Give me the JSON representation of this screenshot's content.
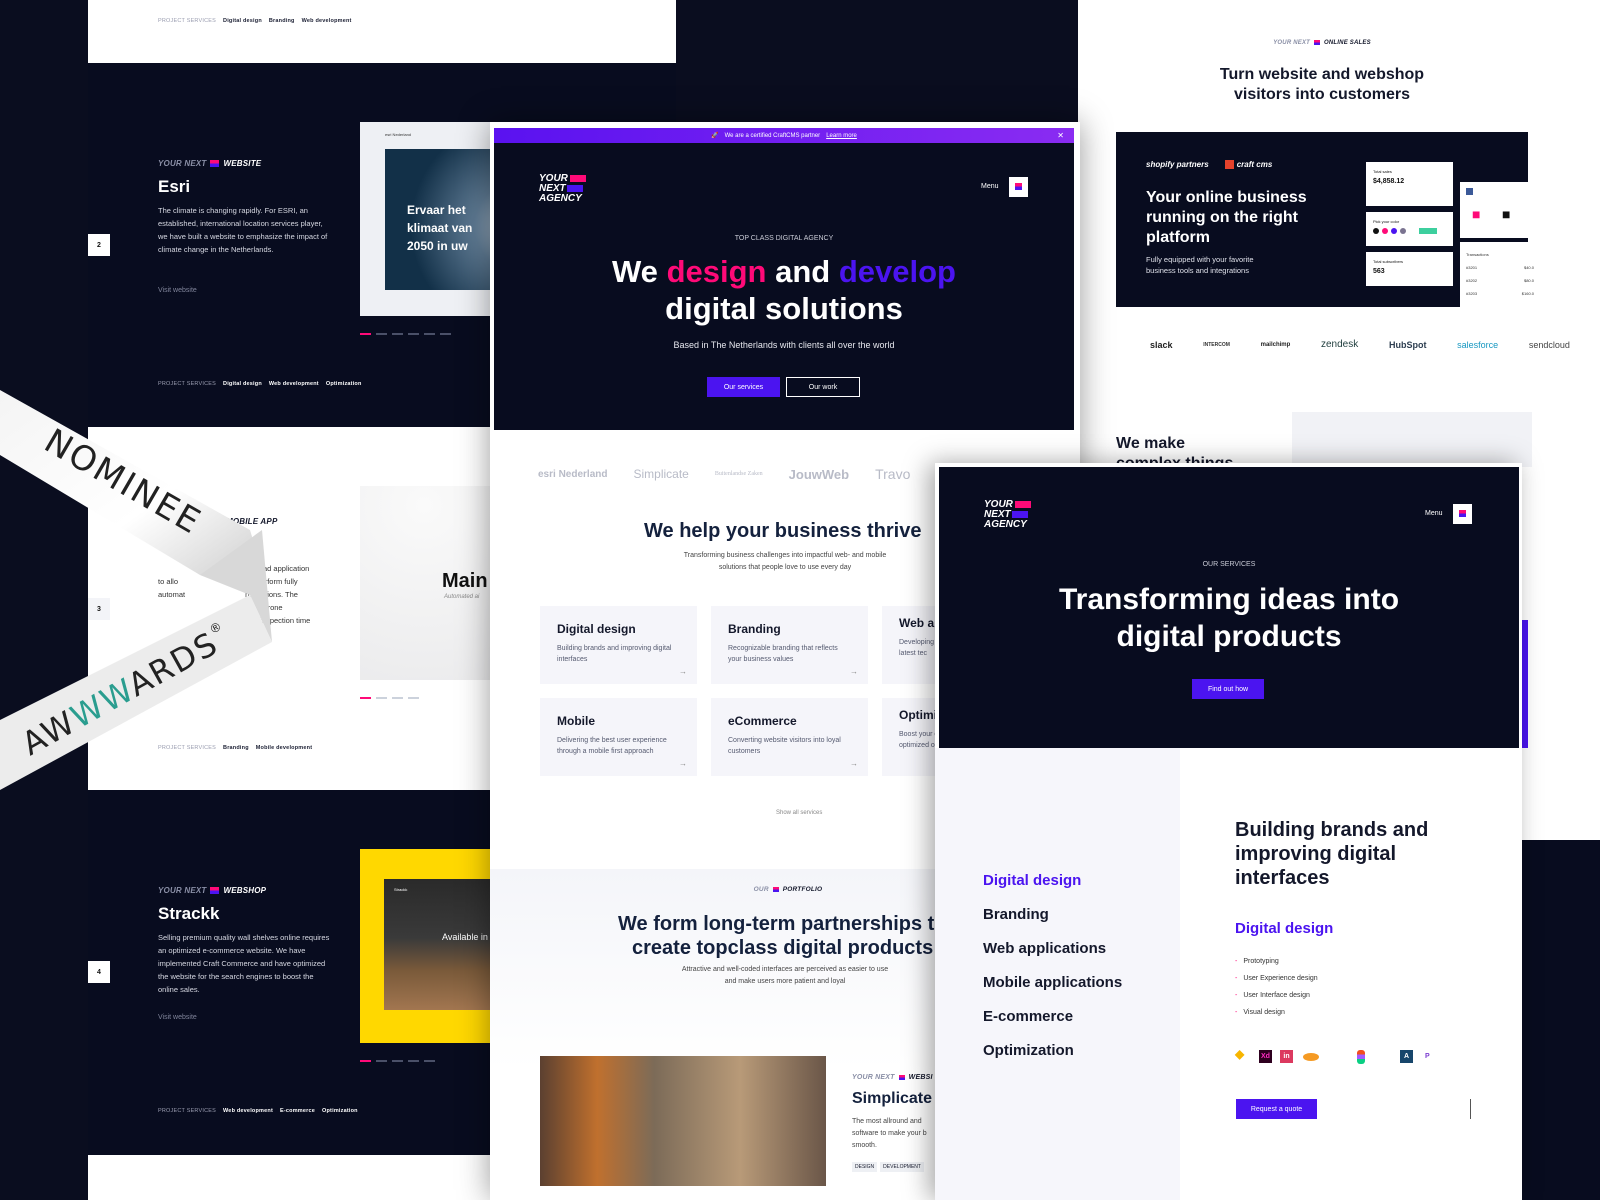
{
  "colors": {
    "navy": "#080c1f",
    "pink": "#ff0a78",
    "purple": "#4b14f0",
    "yellow": "#ffd800"
  },
  "left_panel": {
    "top_services": {
      "label": "PROJECT SERVICES",
      "items": [
        "Digital design",
        "Branding",
        "Web development"
      ]
    },
    "projects": [
      {
        "num": "2",
        "eyebrow_a": "YOUR NEXT",
        "eyebrow_b": "WEBSITE",
        "title": "Esri",
        "desc": "The climate is changing rapidly. For ESRI, an established, international location services player, we have built a website to emphasize the impact of climate change in the Netherlands.",
        "link": "Visit website",
        "preview_text": "Ervaar het klimaat van 2050 in uw",
        "preview_logo": "esri Nederland",
        "services_label": "PROJECT SERVICES",
        "services": [
          "Digital design",
          "Web development",
          "Optimization"
        ]
      },
      {
        "num": "3",
        "eyebrow_b": "MOBILE APP",
        "desc_lines": [
          "Pad application",
          "to allo",
          "to perform fully",
          "automat",
          "nspections. The",
          "ll drone",
          "e inspection time"
        ],
        "preview_logo": "Main",
        "preview_sub": "Automated ai",
        "services_label": "PROJECT SERVICES",
        "services": [
          "Branding",
          "Mobile development"
        ]
      },
      {
        "num": "4",
        "eyebrow_a": "YOUR NEXT",
        "eyebrow_b": "WEBSHOP",
        "title": "Strackk",
        "desc": "Selling premium quality wall shelves online requires an optimized e-commerce website. We have implemented Craft Commerce and have optimized the website for the search engines to boost the online sales.",
        "link": "Visit website",
        "preview_logo": "Strackk",
        "preview_text": "Available in le",
        "services_label": "PROJECT SERVICES",
        "services": [
          "Web development",
          "E-commerce",
          "Optimization"
        ]
      }
    ]
  },
  "ribbon": {
    "line1": "NOMINEE",
    "line2_a": "AW",
    "line2_b": "WW",
    "line2_c": "ARDS",
    "reg": "®"
  },
  "center_panel": {
    "banner": {
      "icon": "rocket-icon",
      "text": "We are a certified CraftCMS partner",
      "link": "Learn more"
    },
    "logo": [
      "YOUR",
      "NEXT",
      "AGENCY"
    ],
    "menu": "Menu",
    "hero": {
      "eyebrow": "TOP CLASS DIGITAL AGENCY",
      "t1": "We",
      "t2": "design",
      "t3": "and",
      "t4": "develop",
      "t5": "digital solutions",
      "sub": "Based in The Netherlands with clients all over the world",
      "btn1": "Our services",
      "btn2": "Our work"
    },
    "clients": [
      "esri Nederland",
      "Simplicate",
      "Buitenlandse Zaken",
      "JouwWeb",
      "Travo"
    ],
    "help": {
      "title": "We help your business thrive",
      "sub1": "Transforming business challenges into impactful web- and mobile",
      "sub2": "solutions that people love to use every day"
    },
    "cards": [
      {
        "title": "Digital design",
        "desc": "Building brands and improving digital interfaces"
      },
      {
        "title": "Branding",
        "desc": "Recognizable branding that reflects your business values"
      },
      {
        "title": "Web ap",
        "desc": "Developing s the latest tec"
      },
      {
        "title": "Mobile",
        "desc": "Delivering the best user experience through a mobile first approach"
      },
      {
        "title": "eCommerce",
        "desc": "Converting website visitors into loyal customers"
      },
      {
        "title": "Optimis",
        "desc": "Boost your o optimized or"
      }
    ],
    "show_all": "Show all services",
    "portfolio": {
      "eyebrow_a": "OUR",
      "eyebrow_b": "PORTFOLIO",
      "t1": "We form long-term partnerships t",
      "t2": "create topclass digital products",
      "s1": "Attractive and well-coded interfaces are perceived as easier to use",
      "s2": "and make users more patient and loyal"
    },
    "case": {
      "eyebrow_a": "YOUR NEXT",
      "eyebrow_b": "WEBSI",
      "title": "Simplicate",
      "desc": "The most allround and software to make your b smooth.",
      "tags": [
        "DESIGN",
        "DEVELOPMENT"
      ]
    }
  },
  "right_panel": {
    "eyebrow_a": "YOUR NEXT",
    "eyebrow_b": "ONLINE SALES",
    "t1": "Turn website and webshop",
    "t2": "visitors into customers",
    "partners": [
      "shopify partners",
      "craft cms"
    ],
    "box_title": [
      "Your online business",
      "running on the right",
      "platform"
    ],
    "box_sub": [
      "Fully equipped with your favorite",
      "business tools and integrations"
    ],
    "widgets": {
      "sales_label": "Total sales",
      "sales": "$4,858.12",
      "color_label": "Pick your color",
      "subs_label": "Total subscribers",
      "subs": "563",
      "tx_label": "Transactions",
      "tx": [
        [
          "#3201",
          "$40.0"
        ],
        [
          "#3202",
          "$80.0"
        ],
        [
          "#3203",
          "$160.0"
        ]
      ]
    },
    "integrations": [
      "slack",
      "INTERCOM",
      "mailchimp",
      "zendesk",
      "HubSpot",
      "salesforce",
      "sendcloud"
    ],
    "complex": [
      "We make",
      "complex things"
    ]
  },
  "services_panel": {
    "logo": [
      "YOUR",
      "NEXT",
      "AGENCY"
    ],
    "menu": "Menu",
    "eyebrow": "OUR SERVICES",
    "t1": "Transforming ideas into",
    "t2": "digital products",
    "btn": "Find out how",
    "nav": [
      "Digital design",
      "Branding",
      "Web applications",
      "Mobile applications",
      "E-commerce",
      "Optimization"
    ],
    "heading": [
      "Building brands and",
      "improving digital",
      "interfaces"
    ],
    "sub": "Digital design",
    "list": [
      "Prototyping",
      "User Experience design",
      "User Interface design",
      "Visual design"
    ],
    "tools": [
      {
        "name": "sketch-icon",
        "label": ""
      },
      {
        "name": "adobe-xd-icon",
        "label": "Xd"
      },
      {
        "name": "invision-icon",
        "label": "in"
      },
      {
        "name": "principle-icon",
        "label": ""
      },
      {
        "name": "figma-icon",
        "label": ""
      },
      {
        "name": "abstract-icon",
        "label": "A"
      },
      {
        "name": "protopie-icon",
        "label": "P"
      }
    ],
    "cta": "Request a quote"
  }
}
